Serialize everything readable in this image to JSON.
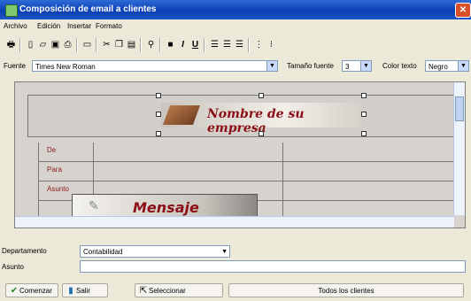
{
  "window": {
    "title": "Composición de email a clientes",
    "close_icon": "close-icon"
  },
  "menu": [
    "Archivo",
    "Edición",
    "Insertar",
    "Formato"
  ],
  "toolbar": {
    "icons": [
      "print-icon",
      "new-doc-icon",
      "open-icon",
      "save-icon",
      "print-preview-icon",
      "comment-icon",
      "cut-icon",
      "copy-icon",
      "paste-icon",
      "find-icon",
      "bold-icon",
      "italic-icon",
      "underline-icon",
      "align-left-icon",
      "align-center-icon",
      "align-right-icon",
      "numbered-list-icon",
      "bullet-list-icon"
    ],
    "glyphs": {
      "bold": "B",
      "italic": "I",
      "underline": "U"
    }
  },
  "fontbar": {
    "font_label": "Fuente",
    "font_value": "Times New Roman",
    "size_label": "Tamaño fuente",
    "size_value": "3",
    "color_label": "Color texto",
    "color_value": "Negro"
  },
  "editor": {
    "brand_text": "Nombre de su empresa",
    "rows": [
      "De",
      "Para",
      "Asunto"
    ],
    "message_text": "Mensaje"
  },
  "form": {
    "department_label": "Departamento",
    "department_value": "Contabilidad",
    "subject_label": "Asunto",
    "subject_value": ""
  },
  "buttons": {
    "compose": "Comenzar",
    "exit": "Salir",
    "select": "Seleccionar",
    "all_clients": "Todos los clientes"
  },
  "colors": {
    "titlebar": "#0a3fb4",
    "brand_text": "#8b0f14",
    "row_label": "#8b1a1a"
  }
}
